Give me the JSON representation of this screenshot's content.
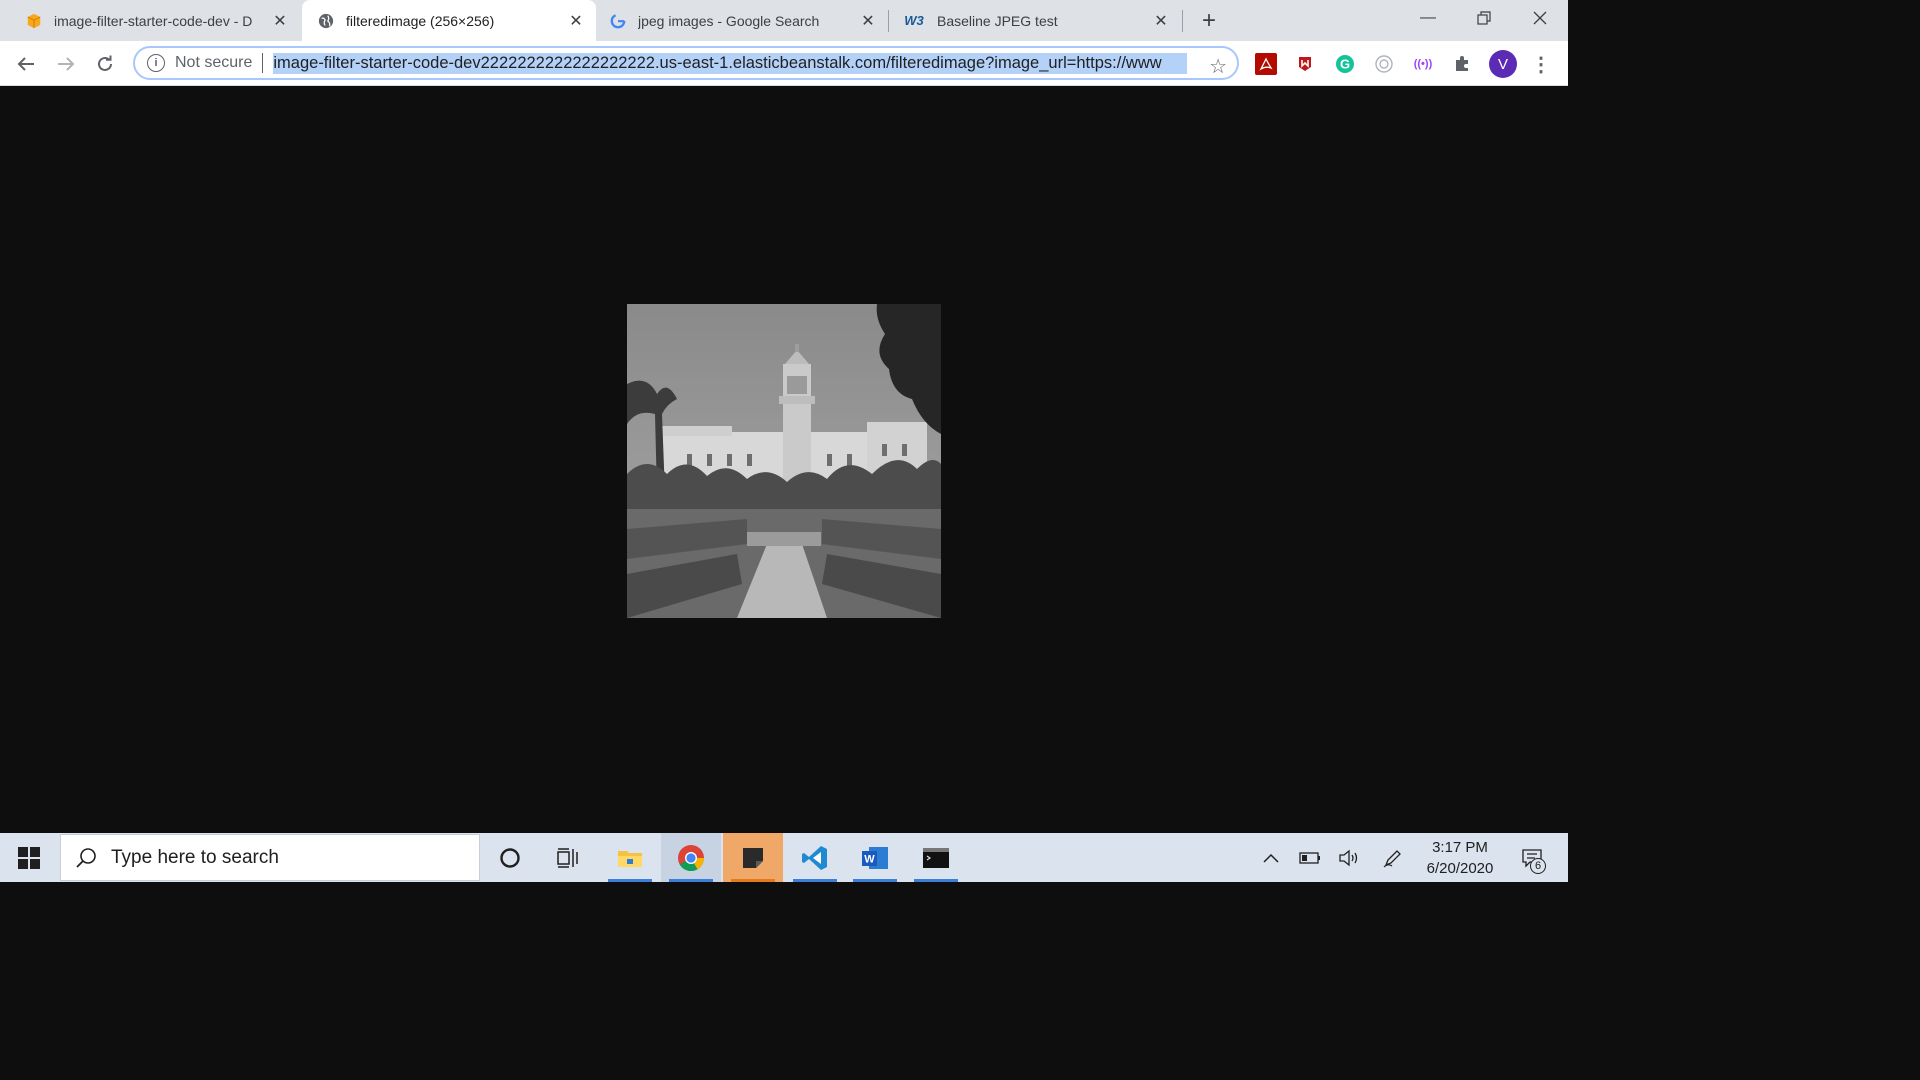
{
  "tabs": [
    {
      "title": "image-filter-starter-code-dev - D",
      "icon": "aws-box-icon"
    },
    {
      "title": "filteredimage (256×256)",
      "icon": "globe-icon"
    },
    {
      "title": "jpeg images - Google Search",
      "icon": "google-icon"
    },
    {
      "title": "Baseline JPEG test",
      "icon": "w3c-icon"
    }
  ],
  "toolbar": {
    "security_label": "Not secure",
    "url": "image-filter-starter-code-dev2222222222222222222.us-east-1.elasticbeanstalk.com/filteredimage?image_url=https://www"
  },
  "extensions": [
    {
      "name": "acrobat-extension-icon",
      "glyph": "A",
      "color": "#b30b00"
    },
    {
      "name": "mcafee-extension-icon",
      "glyph": "M",
      "color": "#c01818"
    },
    {
      "name": "grammarly-extension-icon",
      "glyph": "G",
      "color": "#15c39a"
    },
    {
      "name": "camera-extension-icon",
      "glyph": "◎",
      "color": "#9aa0a6"
    },
    {
      "name": "broadcast-extension-icon",
      "glyph": "((•))",
      "color": "#a142f4"
    },
    {
      "name": "puzzle-extensions-icon",
      "glyph": "✱",
      "color": "#5f6368"
    }
  ],
  "profile": {
    "initial": "V",
    "color": "#5b2bb5"
  },
  "taskbar": {
    "search_placeholder": "Type here to search",
    "time": "3:17 PM",
    "date": "6/20/2020",
    "notifications_count": "6"
  }
}
